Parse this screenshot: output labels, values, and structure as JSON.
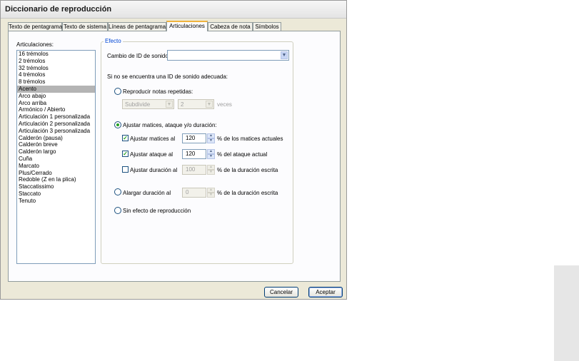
{
  "window": {
    "title": "Diccionario de reproducción"
  },
  "tabs": [
    {
      "label": "Texto de pentagrama"
    },
    {
      "label": "Texto de sistema"
    },
    {
      "label": "Líneas de pentagrama"
    },
    {
      "label": "Articulaciones"
    },
    {
      "label": "Cabeza de nota"
    },
    {
      "label": "Símbolos"
    }
  ],
  "articulations": {
    "label": "Articulaciones:",
    "selected": "Acento",
    "items": [
      "16 trémolos",
      "2 trémolos",
      "32 trémolos",
      "4 trémolos",
      "8 trémolos",
      "Acento",
      "Arco abajo",
      "Arco arriba",
      "Armónico / Abierto",
      "Articulación 1 personalizada",
      "Articulación 2 personalizada",
      "Articulación 3 personalizada",
      "Calderón (pausa)",
      "Calderón breve",
      "Calderón largo",
      "Cuña",
      "Marcato",
      "Plus/Cerrado",
      "Redoble (Z en la plica)",
      "Staccatissimo",
      "Staccato",
      "Tenuto"
    ]
  },
  "effect": {
    "legend": "Efecto",
    "sound_id_label": "Cambio de ID de sonido:",
    "sound_id_value": "",
    "fallback_text": "Si no se encuentra una ID de sonido adecuada:",
    "repeat": {
      "label": "Reproducir notas repetidas:",
      "mode_value": "Subdivide",
      "count_value": "2",
      "unit": "veces",
      "selected": false
    },
    "adjust": {
      "label": "Ajustar matices, ataque y/o duración:",
      "selected": true,
      "dynamics": {
        "label": "Ajustar matices al",
        "value": "120",
        "suffix": "% de los matices actuales",
        "checked": true
      },
      "attack": {
        "label": "Ajustar ataque al",
        "value": "120",
        "suffix": "% del ataque actual",
        "checked": true
      },
      "duration": {
        "label": "Ajustar duración al",
        "value": "100",
        "suffix": "% de la duración escrita",
        "checked": false
      }
    },
    "lengthen": {
      "label": "Alargar duración al",
      "value": "0",
      "suffix": "% de la duración escrita",
      "selected": false
    },
    "none": {
      "label": "Sin efecto de reproducción",
      "selected": false
    }
  },
  "buttons": {
    "cancel": "Cancelar",
    "ok": "Aceptar"
  },
  "colors": {
    "tab_highlight": "#f0b33e",
    "legend": "#0046d5",
    "check_mark": "#21a121",
    "selection": "#b4b4b4"
  }
}
